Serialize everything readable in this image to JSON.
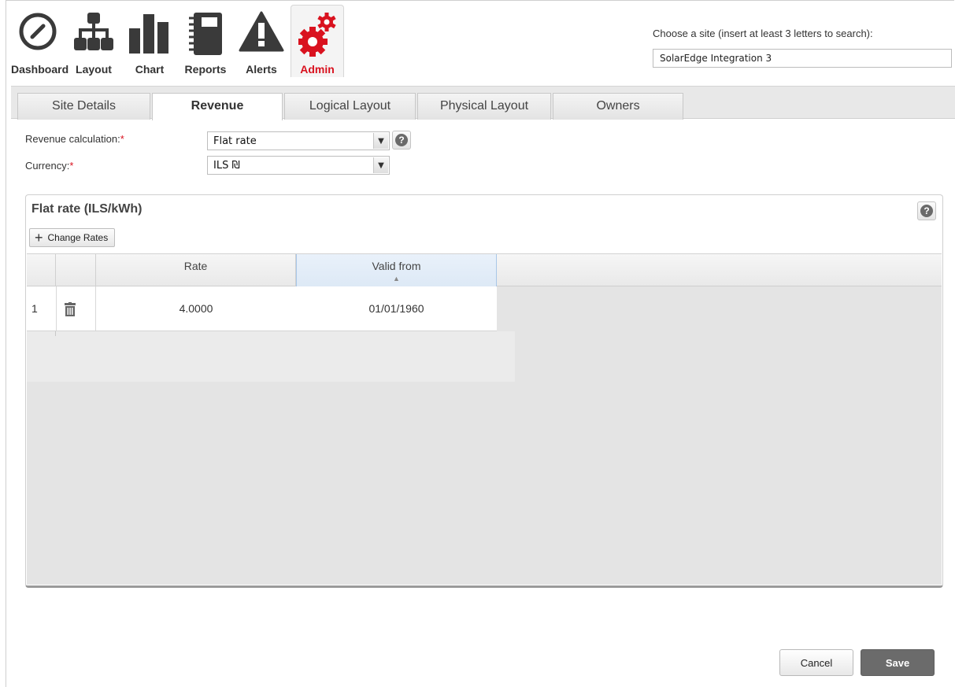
{
  "nav": {
    "items": [
      {
        "label": "Dashboard",
        "icon": "dashboard-icon"
      },
      {
        "label": "Layout",
        "icon": "layout-hierarchy-icon"
      },
      {
        "label": "Chart",
        "icon": "bar-chart-icon"
      },
      {
        "label": "Reports",
        "icon": "notebook-icon"
      },
      {
        "label": "Alerts",
        "icon": "alert-triangle-icon"
      },
      {
        "label": "Admin",
        "icon": "gears-icon"
      }
    ],
    "active": "Admin",
    "accent_color": "#d9121f"
  },
  "site_chooser": {
    "label": "Choose a site (insert at least 3 letters to search):",
    "value": "SolarEdge Integration 3"
  },
  "tabs": [
    {
      "label": "Site Details"
    },
    {
      "label": "Revenue"
    },
    {
      "label": "Logical Layout"
    },
    {
      "label": "Physical Layout"
    },
    {
      "label": "Owners"
    }
  ],
  "active_tab": "Revenue",
  "form": {
    "revenue_calc_label": "Revenue calculation:",
    "revenue_calc_value": "Flat rate",
    "currency_label": "Currency:",
    "currency_value": "ILS ₪",
    "required_marker": "*"
  },
  "panel": {
    "title": "Flat rate (ILS/kWh)",
    "change_rates_label": "Change Rates",
    "columns": [
      "Rate",
      "Valid from"
    ],
    "rows": [
      {
        "index": "1",
        "rate": "4.0000",
        "valid_from": "01/01/1960"
      }
    ]
  },
  "buttons": {
    "cancel": "Cancel",
    "save": "Save"
  }
}
